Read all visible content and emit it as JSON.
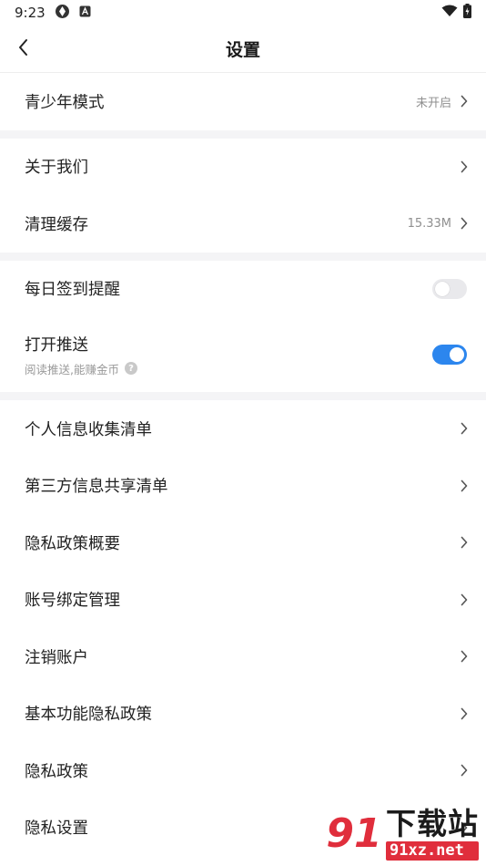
{
  "status": {
    "time": "9:23"
  },
  "header": {
    "title": "设置"
  },
  "sections": {
    "youth": {
      "label": "青少年模式",
      "value": "未开启"
    },
    "about": {
      "label": "关于我们"
    },
    "cache": {
      "label": "清理缓存",
      "value": "15.33M"
    },
    "checkin": {
      "label": "每日签到提醒",
      "enabled": false
    },
    "push": {
      "label": "打开推送",
      "sub": "阅读推送,能赚金币",
      "enabled": true
    },
    "privacy": [
      {
        "label": "个人信息收集清单"
      },
      {
        "label": "第三方信息共享清单"
      },
      {
        "label": "隐私政策概要"
      },
      {
        "label": "账号绑定管理"
      },
      {
        "label": "注销账户"
      },
      {
        "label": "基本功能隐私政策"
      },
      {
        "label": "隐私政策"
      },
      {
        "label": "隐私设置"
      }
    ]
  },
  "watermark": {
    "title": "下载站",
    "url": "91xz.net"
  },
  "colors": {
    "accent": "#2c86ee",
    "divider": "#f4f4f6",
    "watermark_red": "#e02e3c"
  }
}
